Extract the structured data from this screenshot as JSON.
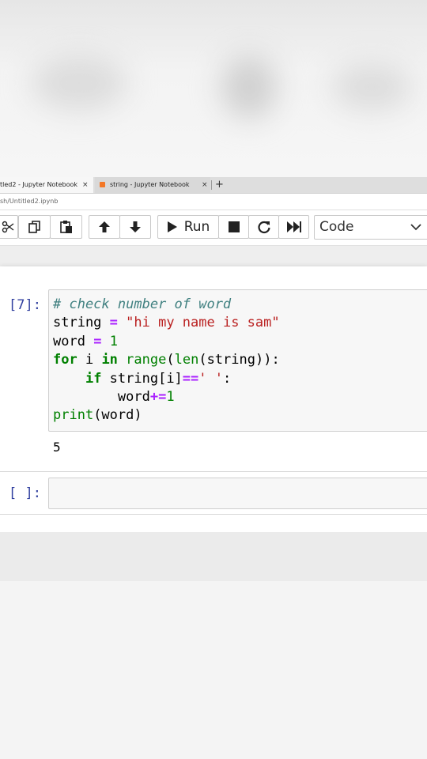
{
  "browser": {
    "tabs": [
      {
        "title": "tled2 - Jupyter Notebook",
        "close": "×"
      },
      {
        "title": "string - Jupyter Notebook",
        "close": "×"
      }
    ],
    "new_tab": "+",
    "url": "sh/Untitled2.ipynb"
  },
  "toolbar": {
    "run_label": "Run",
    "cell_type": "Code",
    "buttons": [
      "cut-icon",
      "copy-icon",
      "paste-icon",
      "move-up-icon",
      "move-down-icon",
      "run-icon",
      "stop-icon",
      "restart-icon",
      "fast-forward-icon"
    ]
  },
  "cells": [
    {
      "prompt": "[7]:",
      "code_lines": [
        "# check number of word",
        "string = \"hi my name is sam\"",
        "word = 1",
        "for i in range(len(string)):",
        "    if string[i]==' ':",
        "        word+=1",
        "print(word)"
      ],
      "output": "5"
    },
    {
      "prompt": "[ ]:",
      "code_lines": []
    }
  ],
  "colors": {
    "prompt": "#303f9f",
    "comment": "#408080",
    "string": "#ba2121",
    "keyword": "#008000",
    "operator": "#aa22ff",
    "cell_bg": "#f7f7f7"
  }
}
